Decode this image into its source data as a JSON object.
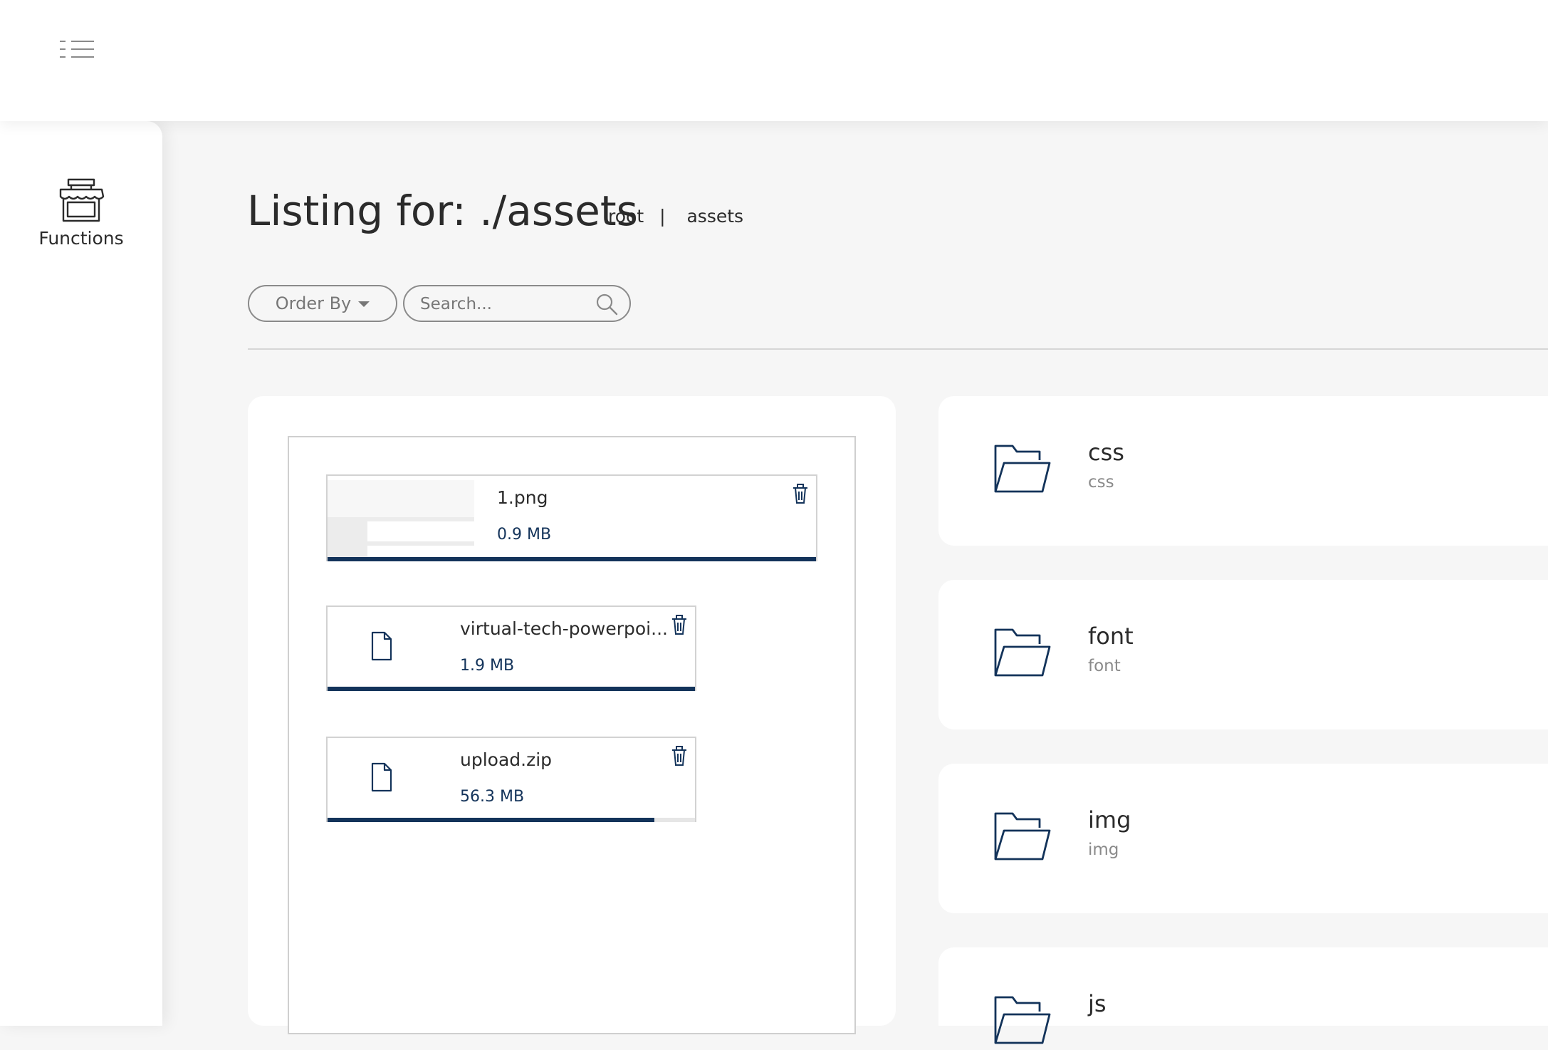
{
  "header": {
    "menu_icon": "list-menu-icon"
  },
  "sidebar": {
    "items": [
      {
        "label": "Functions",
        "icon": "storefront-icon"
      }
    ]
  },
  "page": {
    "title": "Listing for: ./assets",
    "breadcrumb": [
      "root",
      "|",
      "assets"
    ]
  },
  "toolbar": {
    "order_by_label": "Order By",
    "search_placeholder": "Search...",
    "search_value": ""
  },
  "uploads": [
    {
      "name": "1.png",
      "size": "0.9 MB",
      "progress": 1.0,
      "thumbnail": true
    },
    {
      "name": "virtual-tech-powerpoi...",
      "size": "1.9 MB",
      "progress": 1.0,
      "thumbnail": false
    },
    {
      "name": "upload.zip",
      "size": "56.3 MB",
      "progress": 0.89,
      "thumbnail": false
    }
  ],
  "folders": [
    {
      "name": "css",
      "path": "css"
    },
    {
      "name": "font",
      "path": "font"
    },
    {
      "name": "img",
      "path": "img"
    },
    {
      "name": "js",
      "path": ""
    }
  ],
  "colors": {
    "accent": "#13335a",
    "background": "#f6f6f6",
    "card": "#ffffff"
  }
}
